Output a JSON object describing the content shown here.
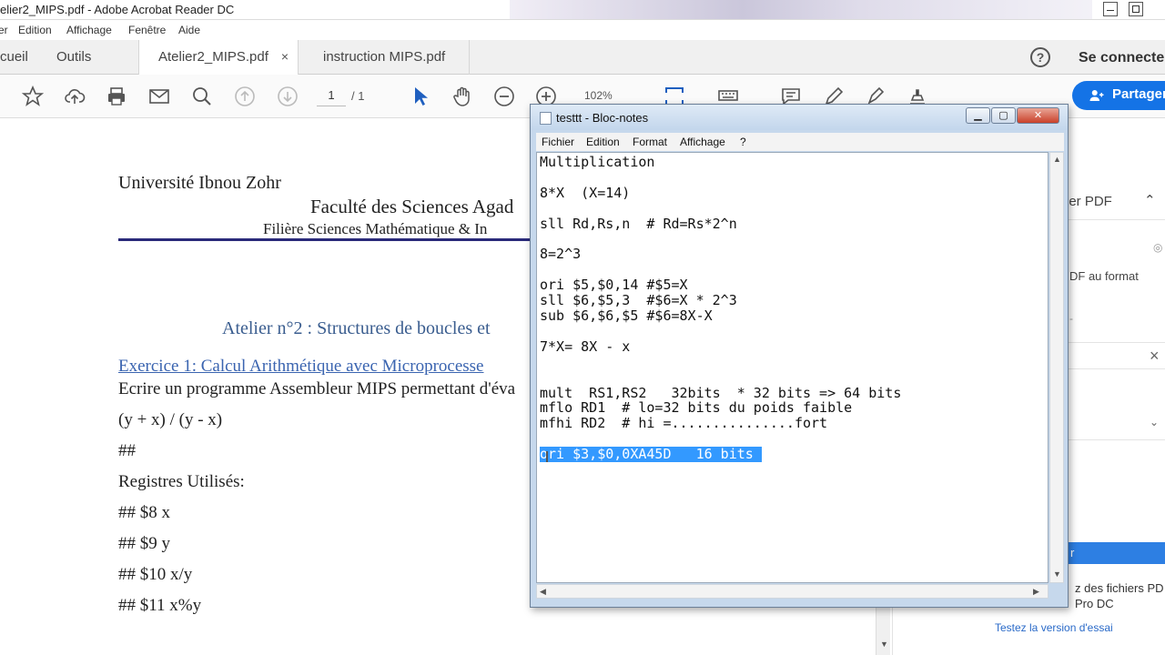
{
  "acrobat": {
    "title": "elier2_MIPS.pdf - Adobe Acrobat Reader DC",
    "menu": [
      "er",
      "Edition",
      "Affichage",
      "Fenêtre",
      "Aide"
    ],
    "tabs": [
      {
        "label": "cueil"
      },
      {
        "label": "Outils"
      },
      {
        "label": "Atelier2_MIPS.pdf",
        "active": true,
        "close": "×"
      },
      {
        "label": "instruction MIPS.pdf"
      }
    ],
    "help_icon": "?",
    "connect_label": "Se connecte",
    "toolbar": {
      "page_current": "1",
      "page_total": "/ 1",
      "zoom": "102%",
      "share_label": "Partager"
    }
  },
  "document": {
    "university": "Université  Ibnou Zohr",
    "faculty": "Faculté des Sciences Agad",
    "filiere": "Filière Sciences Mathématique & In",
    "atelier_title": "Atelier n°2 : Structures de boucles et",
    "exercise_link": "Exercice 1:  Calcul Arithmétique avec Microprocesse",
    "instruction": "Ecrire un programme Assembleur MIPS permettant d'éva",
    "formula": "(y + x) / (y - x)",
    "hash": "##",
    "registers_title": "Registres Utilisés:",
    "registers": [
      "##  $8   x",
      "##  $9   y",
      "##  $10  x/y",
      "##  $11  x%y"
    ]
  },
  "right_pane": {
    "section_label": "ier PDF",
    "export_text": "DF au format",
    "dot": "-",
    "close": "×",
    "promo_line1": "z des fichiers PD",
    "promo_line2": "Pro DC",
    "trial_link": "Testez la version d'essai",
    "button_fragment": "r"
  },
  "notepad": {
    "title": "testtt - Bloc-notes",
    "menu": [
      "Fichier",
      "Edition",
      "Format",
      "Affichage",
      "?"
    ],
    "lines": [
      "Multiplication",
      "",
      "8*X  (X=14)",
      "",
      "sll Rd,Rs,n  # Rd=Rs*2^n",
      "",
      "8=2^3",
      "",
      "ori $5,$0,14 #$5=X",
      "sll $6,$5,3  #$6=X * 2^3",
      "sub $6,$6,$5 #$6=8X-X",
      "",
      "7*X= 8X - x",
      "",
      "",
      "mult  RS1,RS2   32bits  * 32 bits => 64 bits",
      "mflo RD1  # lo=32 bits du poids faible",
      "mfhi RD2  # hi =...............fort",
      "",
      "ori $3,$0,0XA45D   16 bits "
    ],
    "selected_line_index": 19
  }
}
